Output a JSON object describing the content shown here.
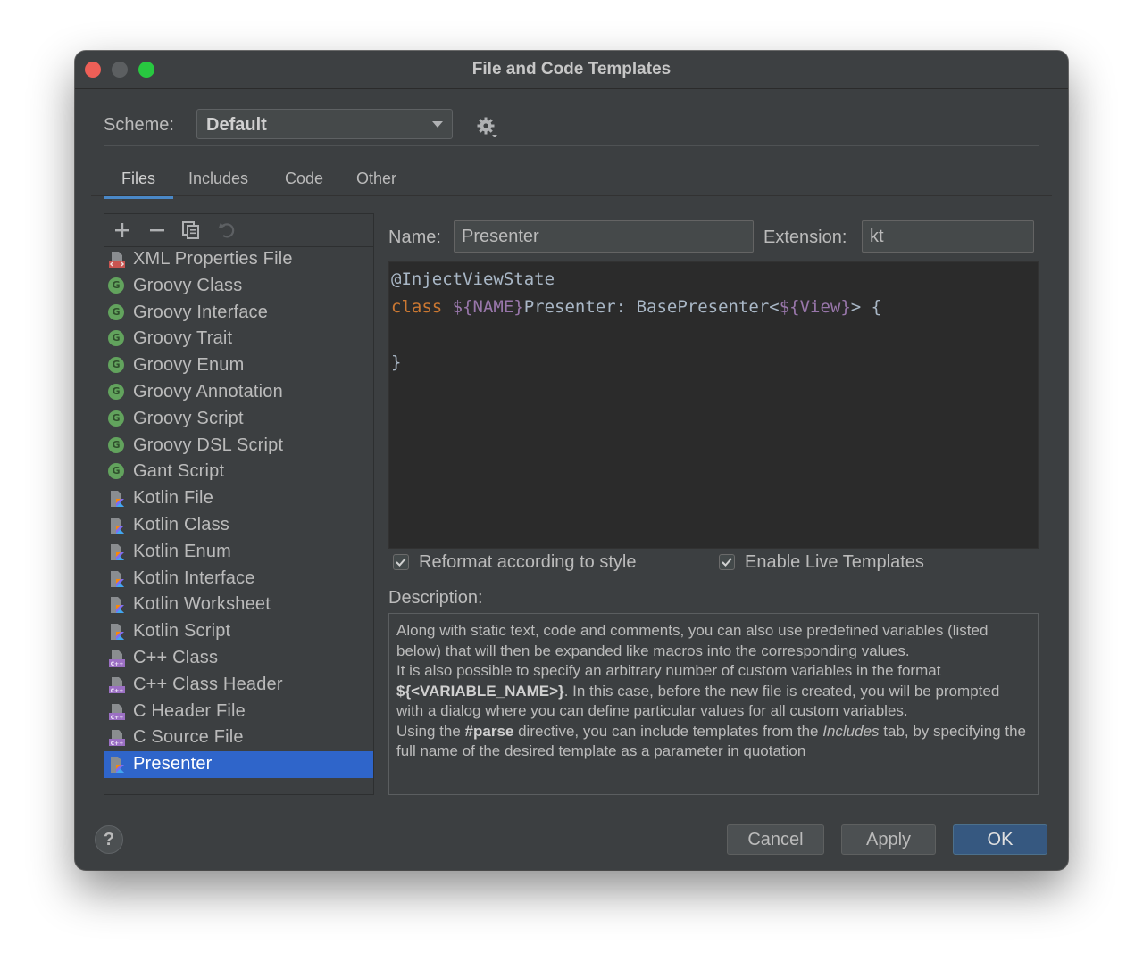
{
  "window": {
    "title": "File and Code Templates"
  },
  "scheme": {
    "label": "Scheme:",
    "value": "Default"
  },
  "tabs": [
    {
      "label": "Files",
      "active": true
    },
    {
      "label": "Includes"
    },
    {
      "label": "Code"
    },
    {
      "label": "Other"
    }
  ],
  "toolbar": {
    "add_icon": "plus-icon",
    "remove_icon": "minus-icon",
    "copy_icon": "copy-icon",
    "reset_icon": "undo-icon"
  },
  "templates": [
    {
      "label": "XML Properties File",
      "icon": "xml-file-icon"
    },
    {
      "label": "Groovy Class",
      "icon": "groovy-icon"
    },
    {
      "label": "Groovy Interface",
      "icon": "groovy-icon"
    },
    {
      "label": "Groovy Trait",
      "icon": "groovy-icon"
    },
    {
      "label": "Groovy Enum",
      "icon": "groovy-icon"
    },
    {
      "label": "Groovy Annotation",
      "icon": "groovy-icon"
    },
    {
      "label": "Groovy Script",
      "icon": "groovy-icon"
    },
    {
      "label": "Groovy DSL Script",
      "icon": "groovy-icon"
    },
    {
      "label": "Gant Script",
      "icon": "groovy-icon"
    },
    {
      "label": "Kotlin File",
      "icon": "kotlin-file-icon"
    },
    {
      "label": "Kotlin Class",
      "icon": "kotlin-file-icon"
    },
    {
      "label": "Kotlin Enum",
      "icon": "kotlin-file-icon"
    },
    {
      "label": "Kotlin Interface",
      "icon": "kotlin-file-icon"
    },
    {
      "label": "Kotlin Worksheet",
      "icon": "kotlin-file-icon"
    },
    {
      "label": "Kotlin Script",
      "icon": "kotlin-file-icon"
    },
    {
      "label": "C++ Class",
      "icon": "cpp-file-icon"
    },
    {
      "label": "C++ Class Header",
      "icon": "cpp-file-icon"
    },
    {
      "label": "C Header File",
      "icon": "cpp-file-icon"
    },
    {
      "label": "C Source File",
      "icon": "cpp-file-icon"
    },
    {
      "label": "Presenter",
      "icon": "kotlin-file-icon",
      "selected": true
    }
  ],
  "form": {
    "name_label": "Name:",
    "name_value": "Presenter",
    "extension_label": "Extension:",
    "extension_value": "kt"
  },
  "code": {
    "line1": "@InjectViewState",
    "line2_kw": "class",
    "line2_var1": "${NAME}",
    "line2_mid": "Presenter: BasePresenter<",
    "line2_var2": "${View}",
    "line2_end": "> {",
    "line3": "",
    "line4": "}"
  },
  "options": {
    "reformat_label": "Reformat according to style",
    "reformat_checked": true,
    "live_templates_label": "Enable Live Templates",
    "live_templates_checked": true
  },
  "description": {
    "label": "Description:",
    "p1": "Along with static text, code and comments, you can also use predefined variables (listed below) that will then be expanded like macros into the corresponding values.",
    "p2a": "It is also possible to specify an arbitrary number of custom variables in the format ",
    "p2b": "${<VARIABLE_NAME>}",
    "p2c": ". In this case, before the new file is created, you will be prompted with a dialog where you can define particular values for all custom variables.",
    "p3a": "Using the ",
    "p3b": "#parse",
    "p3c": " directive, you can include templates from the ",
    "p3d": "Includes",
    "p3e": " tab, by specifying the full name of the desired template as a parameter in quotation"
  },
  "buttons": {
    "help": "?",
    "cancel": "Cancel",
    "apply": "Apply",
    "ok": "OK"
  },
  "colors": {
    "selection": "#2f65ca",
    "ok_button": "#365880",
    "groovy_icon": "#62a35d",
    "keyword": "#cc7832",
    "template_var": "#9876aa"
  }
}
